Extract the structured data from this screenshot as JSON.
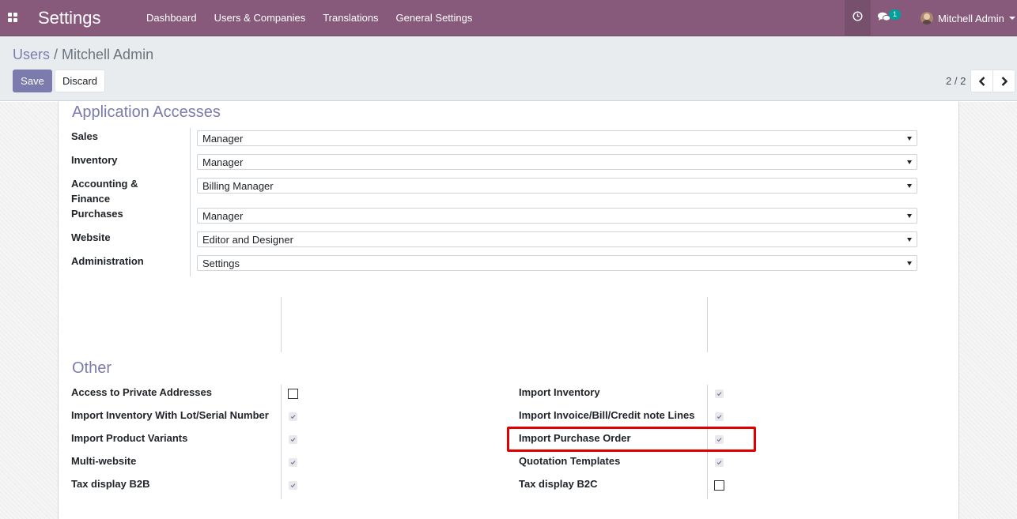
{
  "navbar": {
    "app_title": "Settings",
    "menu": [
      "Dashboard",
      "Users & Companies",
      "Translations",
      "General Settings"
    ],
    "chat_badge_count": "1",
    "user_name": "Mitchell Admin",
    "background_color": "#875a7b"
  },
  "breadcrumb": {
    "parent": "Users",
    "separator": "/",
    "current": "Mitchell Admin"
  },
  "toolbar": {
    "save_label": "Save",
    "discard_label": "Discard"
  },
  "pager": {
    "value": "2 / 2"
  },
  "application_accesses": {
    "title": "Application Accesses",
    "fields": [
      {
        "label": "Sales",
        "value": "Manager"
      },
      {
        "label": "Inventory",
        "value": "Manager"
      },
      {
        "label": "Accounting & Finance",
        "value": "Billing Manager"
      },
      {
        "label": "Purchases",
        "value": "Manager"
      },
      {
        "label": "Website",
        "value": "Editor and Designer"
      },
      {
        "label": "Administration",
        "value": "Settings"
      }
    ]
  },
  "other": {
    "title": "Other",
    "left": [
      {
        "label": "Access to Private Addresses",
        "checked": false
      },
      {
        "label": "Import Inventory With Lot/Serial Number",
        "checked": true
      },
      {
        "label": "Import Product Variants",
        "checked": true
      },
      {
        "label": "Multi-website",
        "checked": true
      },
      {
        "label": "Tax display B2B",
        "checked": true
      }
    ],
    "right": [
      {
        "label": "Import Inventory",
        "checked": true
      },
      {
        "label": "Import Invoice/Bill/Credit note Lines",
        "checked": true
      },
      {
        "label": "Import Purchase Order",
        "checked": true,
        "highlighted": true
      },
      {
        "label": "Quotation Templates",
        "checked": true
      },
      {
        "label": "Tax display B2C",
        "checked": false
      }
    ]
  },
  "colors": {
    "accent": "#7c7bad",
    "highlight": "#e00000"
  }
}
